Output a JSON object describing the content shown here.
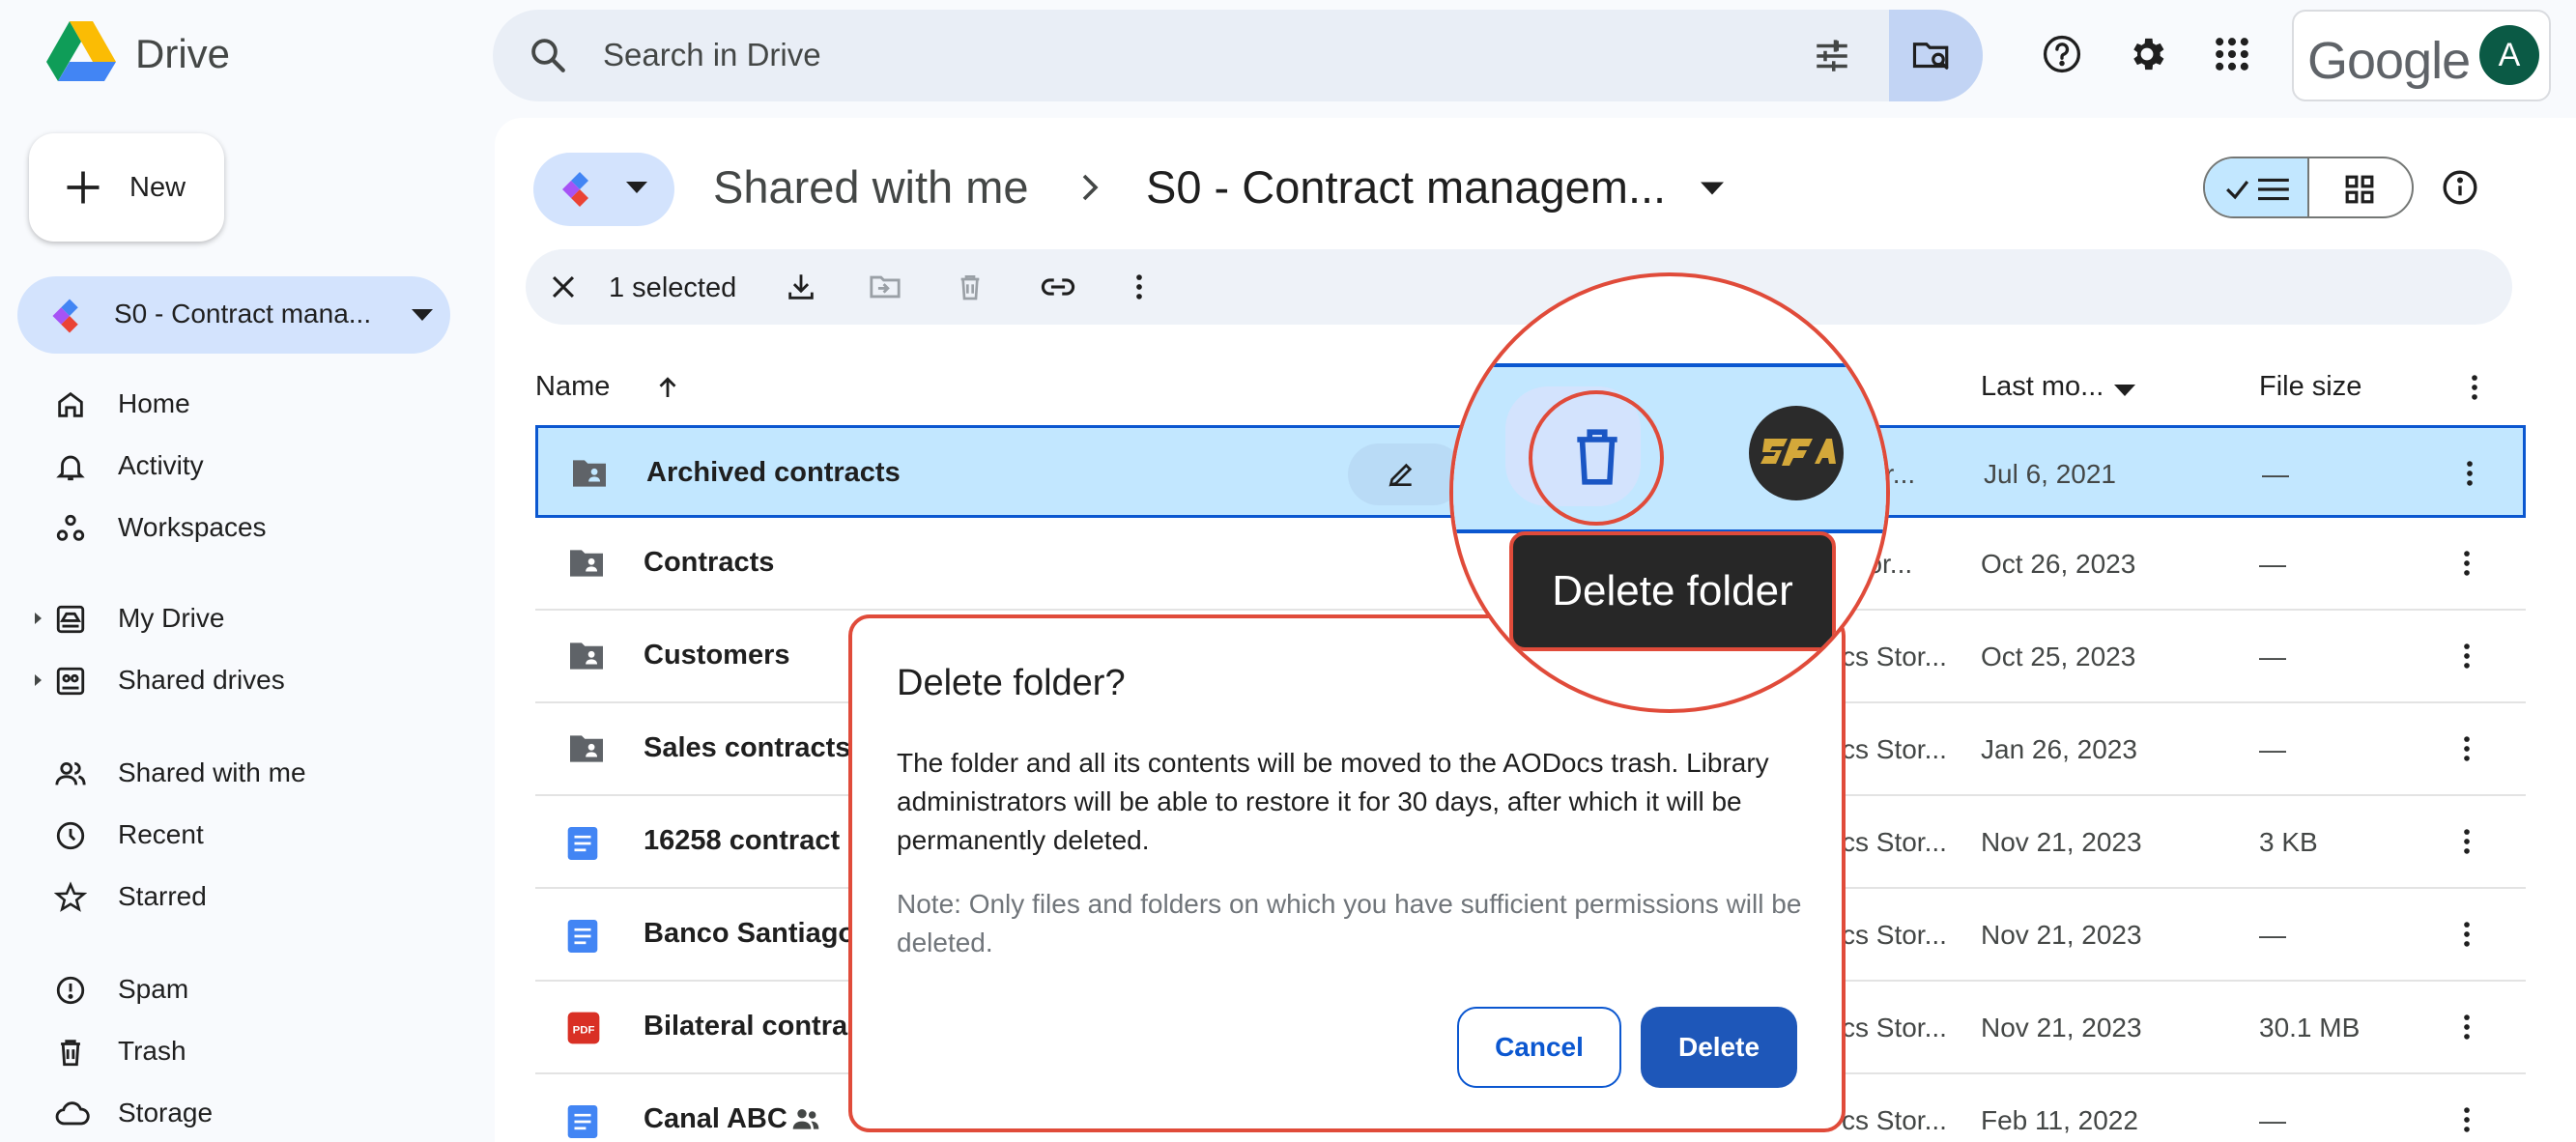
{
  "app": {
    "name": "Drive"
  },
  "search": {
    "placeholder": "Search in Drive"
  },
  "account": {
    "brand": "Google",
    "avatar_letter": "A",
    "avatar_color": "#0b5a45"
  },
  "sidebar": {
    "new_label": "New",
    "library_label": "S0 - Contract mana...",
    "items": [
      {
        "label": "Home",
        "icon": "home-icon"
      },
      {
        "label": "Activity",
        "icon": "bell-icon"
      },
      {
        "label": "Workspaces",
        "icon": "workspaces-icon"
      },
      {
        "label": "My Drive",
        "icon": "my-drive-icon"
      },
      {
        "label": "Shared drives",
        "icon": "shared-drives-icon"
      },
      {
        "label": "Shared with me",
        "icon": "people-icon"
      },
      {
        "label": "Recent",
        "icon": "clock-icon"
      },
      {
        "label": "Starred",
        "icon": "star-icon"
      },
      {
        "label": "Spam",
        "icon": "spam-icon"
      },
      {
        "label": "Trash",
        "icon": "trash-icon"
      },
      {
        "label": "Storage",
        "icon": "cloud-icon"
      }
    ]
  },
  "breadcrumb": {
    "parent": "Shared with me",
    "current": "S0 - Contract managem..."
  },
  "selection": {
    "count_label": "1 selected"
  },
  "columns": {
    "name": "Name",
    "modified": "Last mo...",
    "size": "File size"
  },
  "rows": [
    {
      "name": "Archived contracts",
      "type": "folder",
      "owner": "Stor...",
      "modified": "Jul 6, 2021",
      "size": "—",
      "selected": true
    },
    {
      "name": "Contracts",
      "type": "folder",
      "owner": "Stor...",
      "modified": "Oct 26, 2023",
      "size": "—"
    },
    {
      "name": "Customers",
      "type": "folder",
      "owner": "cs Stor...",
      "modified": "Oct 25, 2023",
      "size": "—"
    },
    {
      "name": "Sales contracts",
      "type": "folder",
      "owner": "cs Stor...",
      "modified": "Jan 26, 2023",
      "size": "—"
    },
    {
      "name": "16258 contract",
      "type": "doc",
      "owner": "cs Stor...",
      "modified": "Nov 21, 2023",
      "size": "3 KB"
    },
    {
      "name": "Banco Santiago",
      "type": "doc",
      "owner": "cs Stor...",
      "modified": "Nov 21, 2023",
      "size": "—"
    },
    {
      "name": "Bilateral contrac",
      "type": "pdf",
      "owner": "cs Stor...",
      "modified": "Nov 21, 2023",
      "size": "30.1 MB"
    },
    {
      "name": "Canal ABC",
      "type": "doc",
      "owner": "cs Stor...",
      "modified": "Feb 11, 2022",
      "size": "—",
      "shared": true
    }
  ],
  "dialog": {
    "title": "Delete folder?",
    "body": "The folder and all its contents will be moved to the AODocs trash. Library administrators will be able to restore it for 30 days, after which it will be permanently deleted.",
    "note": "Note: Only files and folders on which you have sufficient permissions will be deleted.",
    "cancel_label": "Cancel",
    "delete_label": "Delete"
  },
  "magnifier": {
    "tooltip": "Delete folder"
  },
  "colors": {
    "accent": "#0b57d0",
    "selected_row": "#c2e7ff",
    "highlight": "#e04b3a",
    "pdf": "#d93025",
    "doc": "#4285f4"
  }
}
